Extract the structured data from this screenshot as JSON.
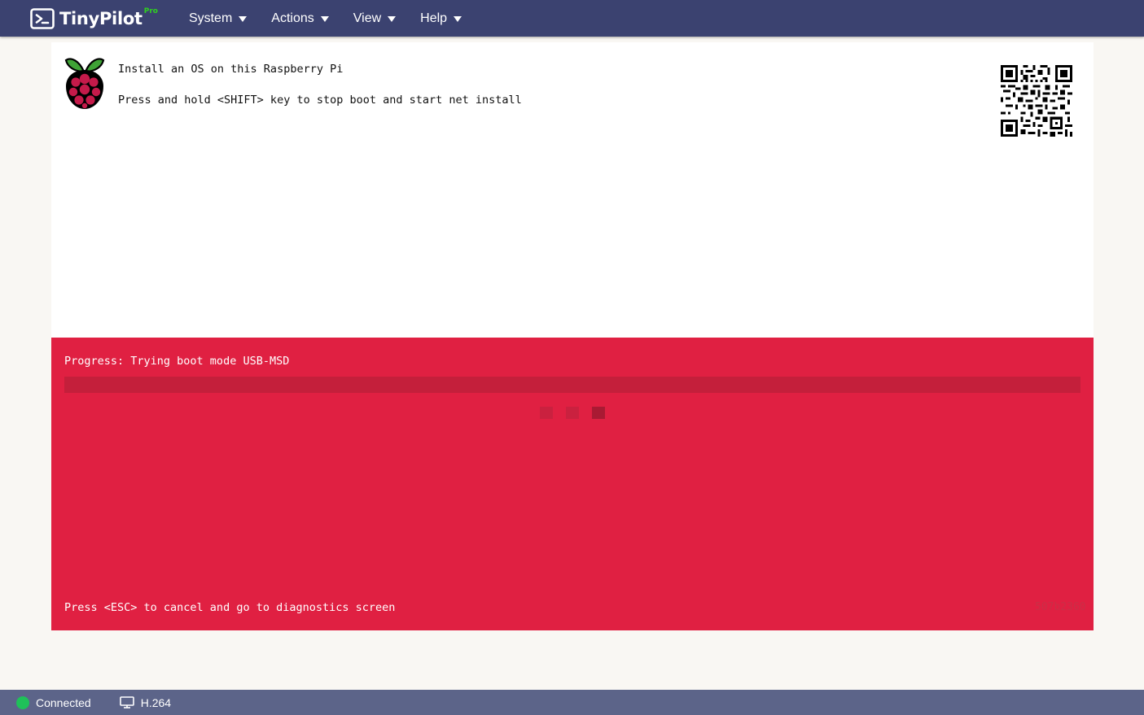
{
  "app": {
    "name": "TinyPilot",
    "badge": "Pro",
    "badge_color": "#2fd21f",
    "brand_color": "#3b4270"
  },
  "menu": {
    "items": [
      {
        "label": "System",
        "icon": "caret-down-icon"
      },
      {
        "label": "Actions",
        "icon": "caret-down-icon"
      },
      {
        "label": "View",
        "icon": "caret-down-icon"
      },
      {
        "label": "Help",
        "icon": "caret-down-icon"
      }
    ]
  },
  "remote_screen": {
    "logo_icon": "raspberry-pi-logo",
    "line1": "Install an OS on this Raspberry Pi",
    "line2": "Press and hold <SHIFT> key to stop boot and start net install",
    "qr_icon": "qr-code",
    "progress_label": "Progress: Trying boot mode USB-MSD",
    "progress_value": 0,
    "esc_hint": "Press <ESC> to cancel and go to diagnostics screen",
    "build_id": "507b2360",
    "panel_color": "#e02042"
  },
  "status": {
    "connection_label": "Connected",
    "connection_color": "#1fc159",
    "codec_icon": "monitor-icon",
    "codec_label": "H.264"
  }
}
